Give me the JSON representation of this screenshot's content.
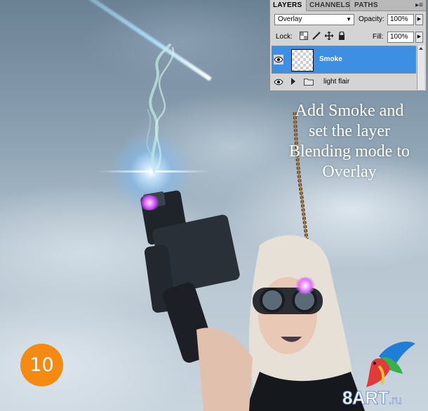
{
  "panel": {
    "tabs": [
      "LAYERS",
      "CHANNELS",
      "PATHS"
    ],
    "menu_icon": "panel-menu-icon",
    "blend_mode": "Overlay",
    "opacity_label": "Opacity:",
    "opacity_value": "100%",
    "lock_label": "Lock:",
    "lock_icons": [
      "lock-transparent-pixels-icon",
      "lock-image-pixels-icon",
      "lock-position-icon",
      "lock-all-icon"
    ],
    "fill_label": "Fill:",
    "fill_value": "100%",
    "layers": [
      {
        "name": "Smoke",
        "selected": true,
        "visible": true,
        "type": "layer"
      },
      {
        "name": "light flair",
        "selected": false,
        "visible": true,
        "type": "group"
      }
    ]
  },
  "caption": {
    "line1": "Add Smoke and",
    "line2": "set the layer",
    "line3": "Blending mode to",
    "line4": "Overlay"
  },
  "step": {
    "number": "10",
    "color": "#f48a12"
  },
  "watermark": {
    "text": "8ART",
    "suffix": ".ru"
  },
  "colors": {
    "selected_layer": "#3d8fe4",
    "panel_bg": "#d4d4d4"
  }
}
